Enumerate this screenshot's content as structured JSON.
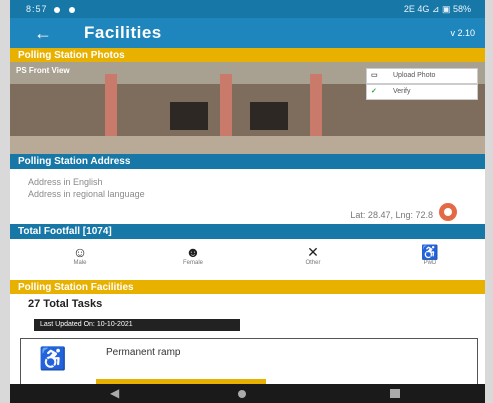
{
  "status_bar": {
    "time": "8:57",
    "right": "2E 4G ⊿ ▣ 58%"
  },
  "header": {
    "title": "Facilities",
    "version": "v 2.10"
  },
  "sections": {
    "photos": "Polling Station Photos",
    "address": "Polling Station Address",
    "footfall": "Total Footfall [1074]",
    "facilities": "Polling Station Facilities"
  },
  "photo": {
    "tag": "PS Front View",
    "upload_label": "Upload Photo",
    "verify_label": "Verify"
  },
  "address": {
    "english": "Address in English",
    "regional": "Address in regional language",
    "coordinates": "Lat: 28.47, Lng: 72.8"
  },
  "counters": [
    {
      "icon": "person-male-icon",
      "label": "Male"
    },
    {
      "icon": "person-female-icon",
      "label": "Female"
    },
    {
      "icon": "handshake-icon",
      "label": "Other"
    },
    {
      "icon": "wheelchair-icon",
      "label": "PwD"
    }
  ],
  "facilities": {
    "total_tasks": "27 Total Tasks",
    "last_updated": "Last Updated On: 10-10-2021",
    "first_item": "Permanent ramp"
  }
}
